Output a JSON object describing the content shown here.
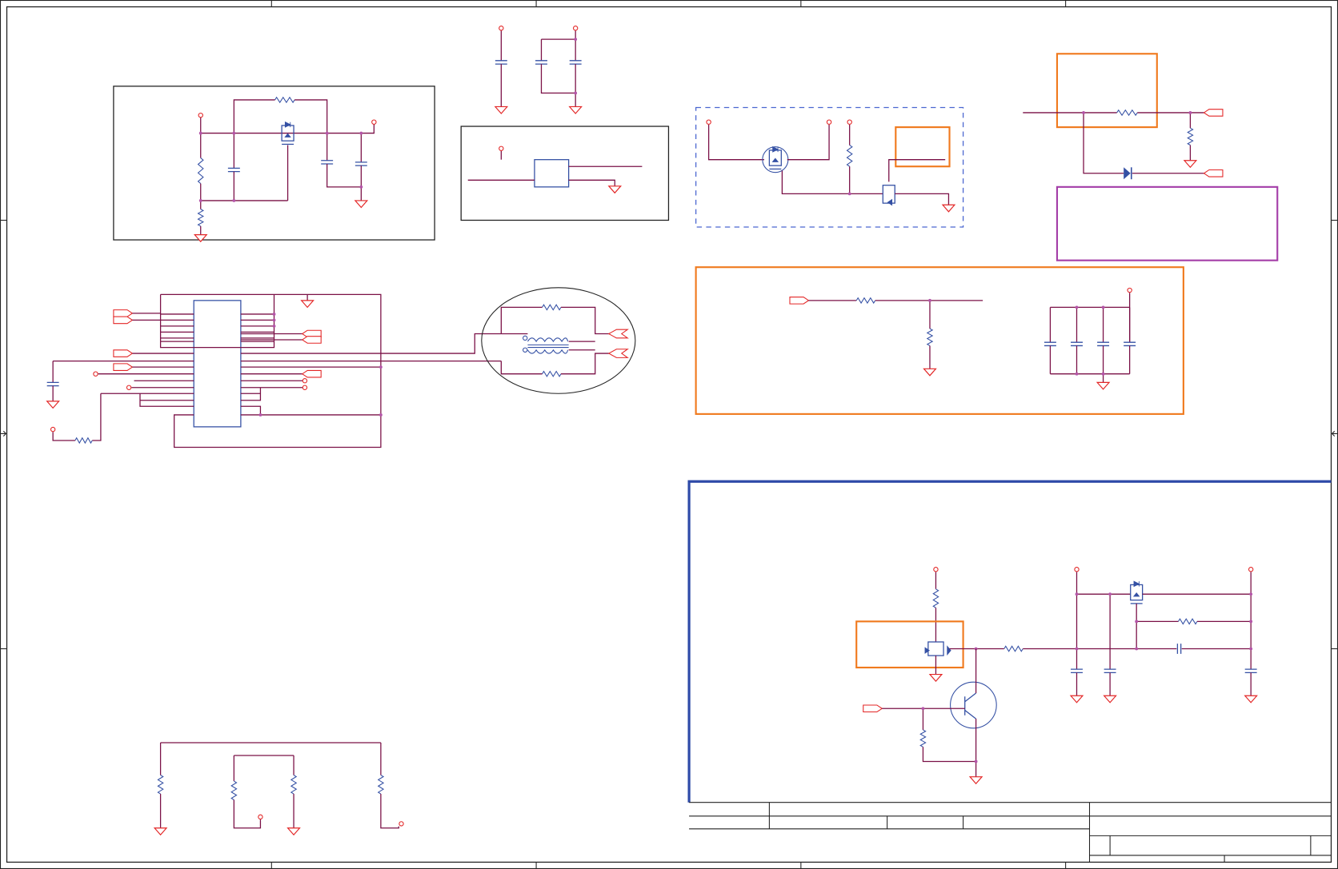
{
  "colors": {
    "wire": "#7a1046",
    "pin": "#e32626",
    "component": "#3450a4",
    "junction": "#b454a8",
    "frame": "#222222",
    "highlight_orange": "#f07a1e",
    "highlight_purple": "#a43ea8",
    "dashed_group": "#4a66d0",
    "panel_border": "#2e4aa8"
  }
}
